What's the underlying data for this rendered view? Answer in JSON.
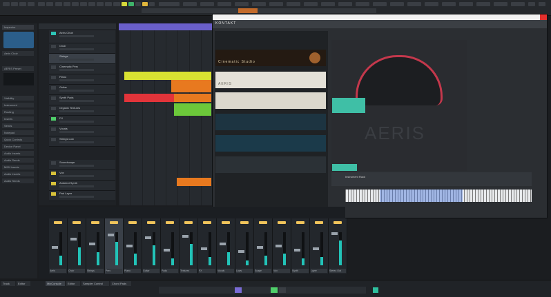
{
  "toolbar": {
    "tabs": [
      "",
      "",
      "",
      "",
      "",
      "",
      "",
      "",
      "",
      "",
      "",
      ""
    ]
  },
  "inspector": {
    "items": [
      "Inspector",
      "Visibility",
      "Instrument",
      "Routing",
      "Inserts",
      "Sends",
      "Notepad",
      "Quick Controls",
      "Device Panel",
      "Audio Inserts",
      "Audio Sends",
      "MIDI Inserts",
      "Audio Inserts",
      "Audio Sends"
    ],
    "preset_label": "AERIS Preset",
    "track_name": "Aeris Choir"
  },
  "tracks": [
    {
      "name": "Aeris Choir",
      "color": "#2ec4b6"
    },
    {
      "name": "Choir",
      "color": "#8f9aa6"
    },
    {
      "name": "Strings",
      "color": "#8f9aa6"
    },
    {
      "name": "Cinematic Perc",
      "color": "#8f9aa6"
    },
    {
      "name": "Piano",
      "color": "#8f9aa6"
    },
    {
      "name": "Guitar",
      "color": "#8f9aa6"
    },
    {
      "name": "Synth Pads",
      "color": "#8f9aa6"
    },
    {
      "name": "Organic Textures",
      "color": "#8f9aa6"
    },
    {
      "name": "FX",
      "color": "#8f9aa6"
    },
    {
      "name": "Vocals",
      "color": "#8f9aa6"
    },
    {
      "name": "Strings Low",
      "color": "#8f9aa6"
    },
    {
      "name": "Soundscape",
      "color": "#8f9aa6"
    },
    {
      "name": "Vox",
      "color": "#8f9aa6"
    },
    {
      "name": "Ambient Synth",
      "color": "#8f9aa6"
    },
    {
      "name": "Pad Layer",
      "color": "#8f9aa6"
    }
  ],
  "regions": [
    {
      "label": "",
      "color": "#d9e232"
    },
    {
      "label": "",
      "color": "#e8791f"
    },
    {
      "label": "",
      "color": "#e2343a"
    },
    {
      "label": "",
      "color": "#e8791f"
    },
    {
      "label": "",
      "color": "#6cc83a"
    },
    {
      "label": "",
      "color": "#e8791f"
    }
  ],
  "kontakt": {
    "title": "KONTAKT",
    "libraries": [
      "Cinematic Studio",
      "AERIS",
      "",
      "",
      "",
      ""
    ],
    "instrument_name": "AERIS",
    "keyboard_label": "Instrument Rack"
  },
  "mixer": {
    "channels": [
      "Aeris",
      "Choir",
      "Strings",
      "Perc",
      "Piano",
      "Guitar",
      "Pads",
      "Textures",
      "FX",
      "Vocals",
      "Lows",
      "Scape",
      "Vox",
      "Synth",
      "Layer",
      "Stereo Out"
    ],
    "levels": [
      0.3,
      0.55,
      0.4,
      0.7,
      0.35,
      0.6,
      0.2,
      0.65,
      0.25,
      0.4,
      0.15,
      0.3,
      0.35,
      0.2,
      0.25,
      0.75
    ]
  },
  "bottom_tabs": [
    "Track",
    "Editor",
    "MixConsole",
    "Editor",
    "Sampler Control",
    "Chord Pads"
  ]
}
